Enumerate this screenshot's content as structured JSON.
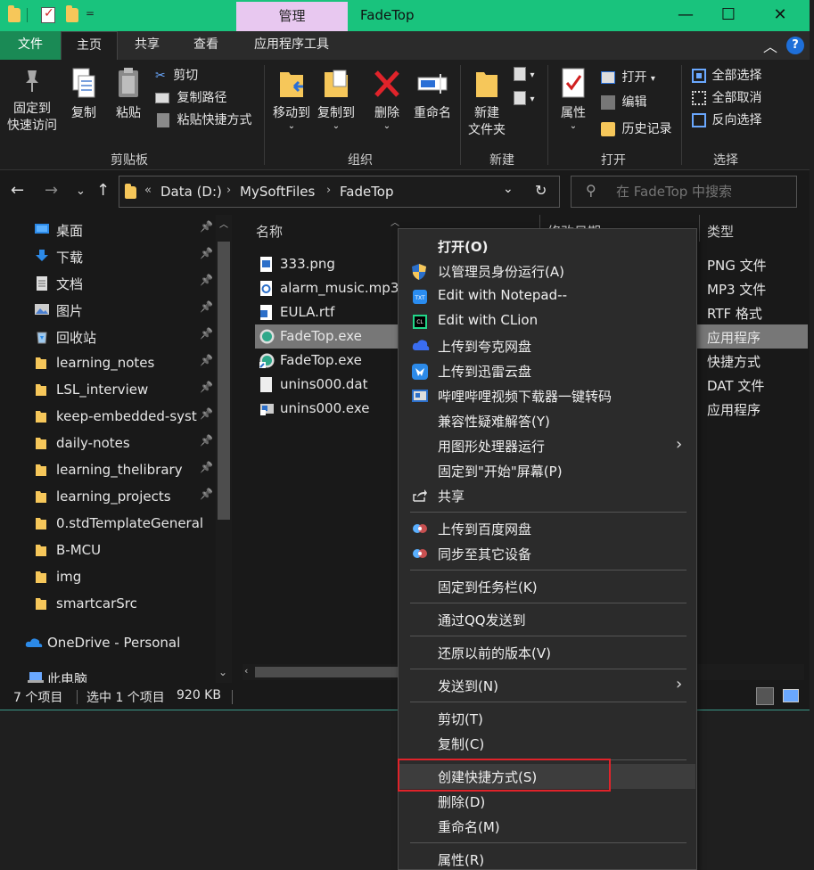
{
  "titlebar": {
    "context_tab": "管理",
    "title": "FadeTop",
    "minimize": "—",
    "maximize": "☐",
    "close": "✕",
    "qa_menu": "="
  },
  "ribbon_tabs": {
    "file": "文件",
    "home": "主页",
    "share": "共享",
    "view": "查看",
    "app_tools": "应用程序工具"
  },
  "ribbon": {
    "clipboard": {
      "label": "剪贴板",
      "pin_quick_access": [
        "固定到",
        "快速访问"
      ],
      "copy": "复制",
      "paste": "粘贴",
      "cut": "剪切",
      "copy_path": "复制路径",
      "paste_shortcut": "粘贴快捷方式"
    },
    "organize": {
      "label": "组织",
      "move_to": "移动到",
      "copy_to": "复制到",
      "delete": "删除",
      "rename": "重命名"
    },
    "new": {
      "label": "新建",
      "new_folder": [
        "新建",
        "文件夹"
      ]
    },
    "open": {
      "label": "打开",
      "properties": "属性",
      "open": "打开",
      "edit": "编辑",
      "history": "历史记录"
    },
    "select": {
      "label": "选择",
      "select_all": "全部选择",
      "select_none": "全部取消",
      "invert": "反向选择"
    }
  },
  "address": {
    "overflow": "«",
    "crumbs": [
      "Data (D:)",
      "MySoftFiles",
      "FadeTop"
    ],
    "search_placeholder": "在 FadeTop 中搜索"
  },
  "nav": {
    "items": [
      {
        "label": "桌面",
        "icon": "desktop-icon",
        "pinned": true
      },
      {
        "label": "下载",
        "icon": "download-icon",
        "pinned": true
      },
      {
        "label": "文档",
        "icon": "document-icon",
        "pinned": true
      },
      {
        "label": "图片",
        "icon": "pictures-icon",
        "pinned": true
      },
      {
        "label": "回收站",
        "icon": "recycle-bin-icon",
        "pinned": true
      },
      {
        "label": "learning_notes",
        "icon": "folder-icon",
        "pinned": true
      },
      {
        "label": "LSL_interview",
        "icon": "folder-icon",
        "pinned": true
      },
      {
        "label": "keep-embedded-syst",
        "icon": "folder-icon",
        "pinned": true
      },
      {
        "label": "daily-notes",
        "icon": "folder-icon",
        "pinned": true
      },
      {
        "label": "learning_thelibrary",
        "icon": "folder-icon",
        "pinned": true
      },
      {
        "label": "learning_projects",
        "icon": "folder-icon",
        "pinned": true
      },
      {
        "label": "0.stdTemplateGeneral",
        "icon": "folder-icon",
        "pinned": false
      },
      {
        "label": "B-MCU",
        "icon": "folder-icon",
        "pinned": false
      },
      {
        "label": "img",
        "icon": "folder-icon",
        "pinned": false
      },
      {
        "label": "smartcarSrc",
        "icon": "folder-icon",
        "pinned": false
      }
    ],
    "onedrive": "OneDrive - Personal",
    "this_pc": "此电脑"
  },
  "content": {
    "columns": {
      "name": "名称",
      "modified": "修改日期",
      "type": "类型"
    },
    "files": [
      {
        "name": "333.png",
        "type": "PNG 文件",
        "icon": "image-file-icon"
      },
      {
        "name": "alarm_music.mp3",
        "type": "MP3 文件",
        "icon": "audio-file-icon"
      },
      {
        "name": "EULA.rtf",
        "type": "RTF 格式",
        "icon": "rtf-file-icon"
      },
      {
        "name": "FadeTop.exe",
        "type": "应用程序",
        "icon": "fadetop-app-icon",
        "selected": true
      },
      {
        "name": "FadeTop.exe",
        "type": "快捷方式",
        "icon": "fadetop-shortcut-icon"
      },
      {
        "name": "unins000.dat",
        "type": "DAT 文件",
        "icon": "dat-file-icon"
      },
      {
        "name": "unins000.exe",
        "type": "应用程序",
        "icon": "installer-icon"
      }
    ]
  },
  "status": {
    "count": "7 个项目",
    "selected": "选中 1 个项目",
    "size": "920 KB"
  },
  "context_menu": {
    "items": [
      {
        "label": "打开(O)",
        "bold": true
      },
      {
        "label": "以管理员身份运行(A)",
        "icon": "uac-shield-icon"
      },
      {
        "label": "Edit with Notepad--",
        "icon": "notepad-icon"
      },
      {
        "label": "Edit with CLion",
        "icon": "clion-icon"
      },
      {
        "label": "上传到夸克网盘",
        "icon": "quark-cloud-icon"
      },
      {
        "label": "上传到迅雷云盘",
        "icon": "thunder-icon"
      },
      {
        "label": "哔哩哔哩视频下载器一键转码",
        "icon": "bilibili-icon"
      },
      {
        "label": "兼容性疑难解答(Y)"
      },
      {
        "label": "用图形处理器运行",
        "submenu": true
      },
      {
        "label": "固定到\"开始\"屏幕(P)"
      },
      {
        "label": "共享",
        "icon": "share-icon"
      },
      {
        "label": "上传到百度网盘",
        "icon": "baidu-cloud-icon"
      },
      {
        "label": "同步至其它设备",
        "icon": "baidu-sync-icon"
      },
      {
        "label": "固定到任务栏(K)"
      },
      {
        "label": "通过QQ发送到"
      },
      {
        "label": "还原以前的版本(V)"
      },
      {
        "label": "发送到(N)",
        "submenu": true
      },
      {
        "label": "剪切(T)"
      },
      {
        "label": "复制(C)"
      },
      {
        "label": "创建快捷方式(S)"
      },
      {
        "label": "删除(D)"
      },
      {
        "label": "重命名(M)"
      },
      {
        "label": "属性(R)"
      }
    ]
  }
}
